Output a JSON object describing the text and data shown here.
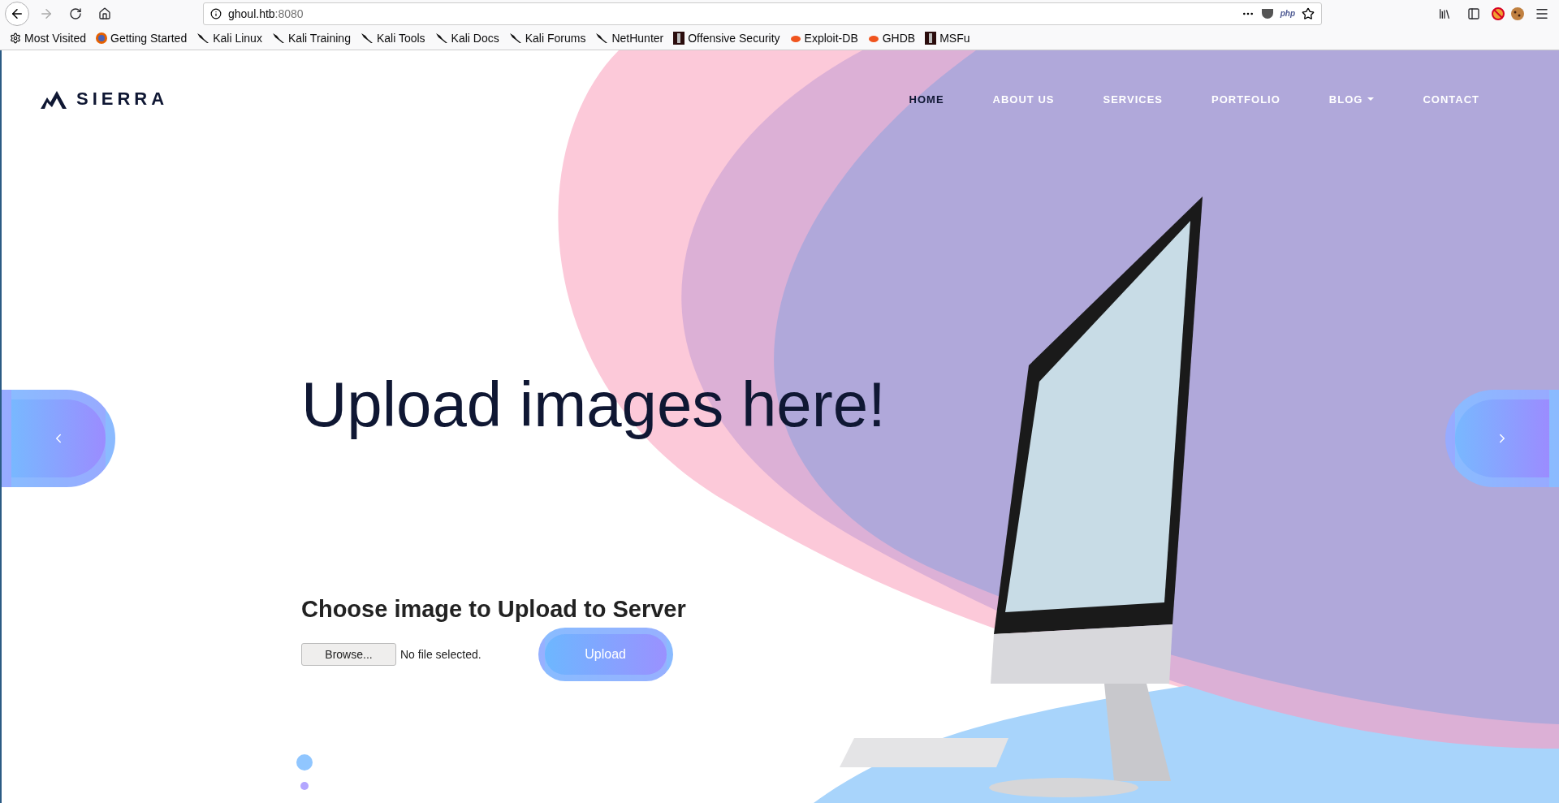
{
  "browser": {
    "url_host": "ghoul.htb",
    "url_port": ":8080",
    "bookmarks": [
      {
        "kind": "settings",
        "label": "Most Visited"
      },
      {
        "kind": "browser",
        "label": "Getting Started"
      },
      {
        "kind": "kali",
        "label": "Kali Linux"
      },
      {
        "kind": "kali",
        "label": "Kali Training"
      },
      {
        "kind": "kali",
        "label": "Kali Tools"
      },
      {
        "kind": "kali",
        "label": "Kali Docs"
      },
      {
        "kind": "kali",
        "label": "Kali Forums"
      },
      {
        "kind": "kali",
        "label": "NetHunter"
      },
      {
        "kind": "offsec",
        "label": "Offensive Security"
      },
      {
        "kind": "bug",
        "label": "Exploit-DB"
      },
      {
        "kind": "bug",
        "label": "GHDB"
      },
      {
        "kind": "offsec",
        "label": "MSFu"
      }
    ],
    "php_badge": "php"
  },
  "site": {
    "logo": "SIERRA",
    "nav": [
      {
        "label": "HOME",
        "selected": true,
        "dropdown": false
      },
      {
        "label": "ABOUT US",
        "selected": false,
        "dropdown": false
      },
      {
        "label": "SERVICES",
        "selected": false,
        "dropdown": false
      },
      {
        "label": "PORTFOLIO",
        "selected": false,
        "dropdown": false
      },
      {
        "label": "BLOG",
        "selected": false,
        "dropdown": true
      },
      {
        "label": "CONTACT",
        "selected": false,
        "dropdown": false
      }
    ],
    "headline": "Upload images here!",
    "upload": {
      "title": "Choose image to Upload to Server",
      "browse": "Browse...",
      "file_status": "No file selected.",
      "submit": "Upload"
    },
    "slider_dots": [
      {
        "selected": true
      },
      {
        "selected": false
      }
    ]
  }
}
